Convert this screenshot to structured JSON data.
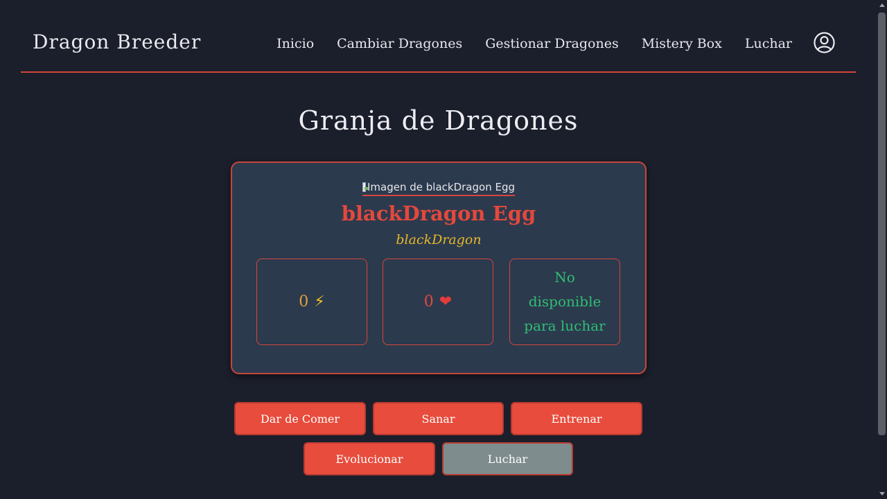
{
  "header": {
    "brand": "Dragon Breeder",
    "nav": [
      "Inicio",
      "Cambiar Dragones",
      "Gestionar Dragones",
      "Mistery Box",
      "Luchar"
    ],
    "user_icon": "user-circle-icon"
  },
  "main": {
    "title": "Granja de Dragones",
    "card": {
      "image_alt": "Imagen de blackDragon Egg",
      "name": "blackDragon Egg",
      "type": "blackDragon",
      "energy": "0",
      "energy_icon": "⚡",
      "health": "0",
      "health_icon": "❤",
      "fight_status": "No disponible para luchar"
    },
    "buttons": {
      "feed": "Dar de Comer",
      "heal": "Sanar",
      "train": "Entrenar",
      "evolve": "Evolucionar",
      "fight": "Luchar"
    }
  },
  "colors": {
    "background": "#1b1f2b",
    "card": "#2c3a4e",
    "accent": "#e74c3c",
    "type_yellow": "#e5b82a",
    "status_green": "#2fbf72",
    "disabled_button": "#7f8c8d"
  }
}
